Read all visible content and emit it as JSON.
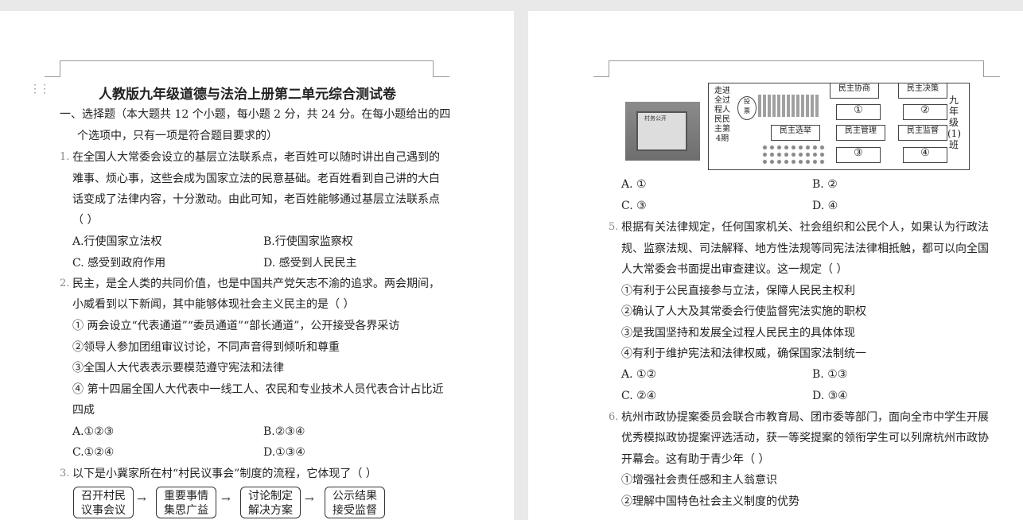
{
  "left_page": {
    "title": "人教版九年级道德与法治上册第二单元综合测试卷",
    "section1": [
      "一、选择题（本大题共  12 个小题，每小题 2 分，共 24 分。在每小题给出的四",
      "个选项中，只有一项是符合题目要求的）"
    ],
    "q1": {
      "num": "1.",
      "lines": [
        "在全国人大常委会设立的基层立法联系点，老百姓可以随时讲出自己遇到的",
        "难事、烦心事，这些会成为国家立法的民意基础。老百姓看到自己讲的大白",
        "话变成了法律内容，十分激动。由此可知，老百姓能够通过基层立法联系点",
        "（          ）"
      ],
      "a": "A.行使国家立法权",
      "b": "B.行使国家监察权",
      "c": "C. 感受到政府作用",
      "d": "D. 感受到人民民主"
    },
    "q2": {
      "num": "2.",
      "lines": [
        "民主，是全人类的共同价值，也是中国共产党矢志不渝的追求。两会期间，",
        "小威看到以下新闻，其中能够体现社会主义民主的是（          ）"
      ],
      "items": [
        "① 两会设立“代表通道”“委员通道”“部长通道”，公开接受各界采访",
        "②领导人参加团组审议讨论，不同声音得到倾听和尊重",
        "③全国人大代表表示要模范遵守宪法和法律",
        "④ 第十四届全国人大代表中一线工人、农民和专业技术人员代表合计占比近",
        "四成"
      ],
      "a": "A.①②③",
      "b": "B.②③④",
      "c": "C.①②④",
      "d": "D.①③④"
    },
    "q3": {
      "num": "3.",
      "line": "以下是小冀家所在村“村民议事会”制度的流程，它体现了（          ）",
      "flow": [
        [
          "召开村民",
          "议事会议"
        ],
        [
          "重要事情",
          "集思广益"
        ],
        [
          "讨论制定",
          "解决方案"
        ],
        [
          "公示结果",
          "接受监督"
        ]
      ]
    }
  },
  "right_page": {
    "figure": {
      "photo_label": "村务公开",
      "vtitle": "走进全过程人民民主第4期",
      "vclass": "九年级(1)班",
      "boxes": [
        "民主协商",
        "民主决策",
        "民主选举",
        "民主管理",
        "民主监督"
      ],
      "circles": [
        "①",
        "②",
        "③",
        "④"
      ],
      "stamp": [
        "投",
        "票"
      ]
    },
    "q3opts": {
      "a": "A. ①",
      "b": "B. ②",
      "c": "C. ③",
      "d": "D. ④"
    },
    "q5": {
      "num": "5.",
      "lines": [
        "根据有关法律规定，任何国家机关、社会组织和公民个人，如果认为行政法",
        "规、监察法规、司法解释、地方性法规等同宪法法律相抵触，都可以向全国",
        "人大常委会书面提出审查建议。这一规定（          ）"
      ],
      "items": [
        "①有利于公民直接参与立法，保障人民民主权利",
        "②确认了人大及其常委会行使监督宪法实施的职权",
        "③是我国坚持和发展全过程人民民主的具体体现",
        "④有利于维护宪法和法律权威，确保国家法制统一"
      ],
      "a": "A. ①②",
      "b": "B. ①③",
      "c": "C. ②④",
      "d": "D. ③④"
    },
    "q6": {
      "num": "6.",
      "lines": [
        "杭州市政协提案委员会联合市教育局、团市委等部门，面向全市中学生开展",
        "优秀模拟政协提案评选活动，获一等奖提案的领衔学生可以列席杭州市政协",
        "开幕会。这有助于青少年（          ）"
      ],
      "items": [
        "①增强社会责任感和主人翁意识",
        "②理解中国特色社会主义制度的优势"
      ]
    }
  }
}
